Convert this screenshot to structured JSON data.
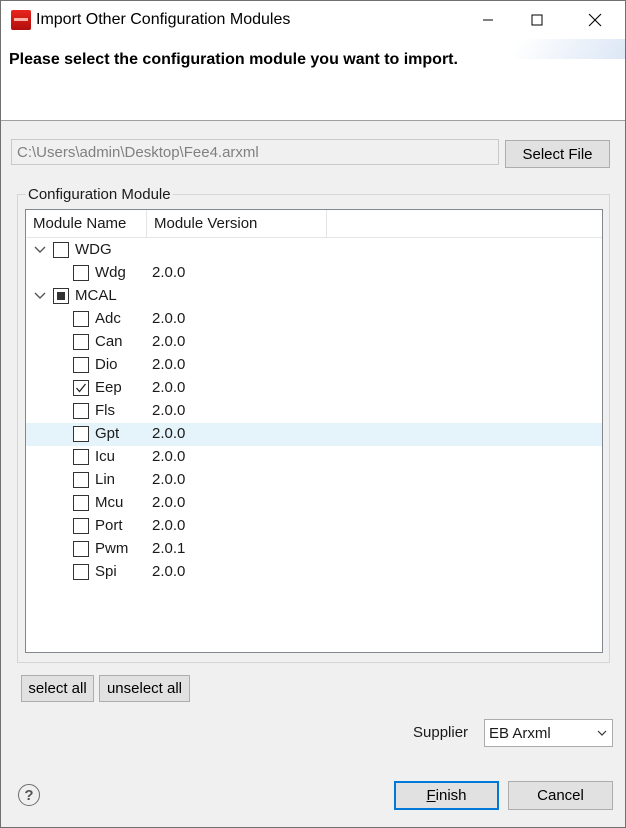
{
  "window": {
    "title": "Import Other Configuration Modules",
    "app_icon": "app-logo-icon",
    "controls": [
      "minimize-icon",
      "maximize-icon",
      "close-icon"
    ]
  },
  "banner": {
    "message": "Please select the configuration module you want to import."
  },
  "file": {
    "path": "C:\\Users\\admin\\Desktop\\Fee4.arxml",
    "select_button": "Select File"
  },
  "config_group": {
    "label": "Configuration Module",
    "columns": [
      "Module Name",
      "Module Version"
    ],
    "tree": [
      {
        "label": "WDG",
        "level": 0,
        "expanded": true,
        "state": "unchecked",
        "version": ""
      },
      {
        "label": "Wdg",
        "level": 1,
        "state": "unchecked",
        "version": "2.0.0"
      },
      {
        "label": "MCAL",
        "level": 0,
        "expanded": true,
        "state": "partial",
        "version": ""
      },
      {
        "label": "Adc",
        "level": 1,
        "state": "unchecked",
        "version": "2.0.0"
      },
      {
        "label": "Can",
        "level": 1,
        "state": "unchecked",
        "version": "2.0.0"
      },
      {
        "label": "Dio",
        "level": 1,
        "state": "unchecked",
        "version": "2.0.0"
      },
      {
        "label": "Eep",
        "level": 1,
        "state": "checked",
        "version": "2.0.0"
      },
      {
        "label": "Fls",
        "level": 1,
        "state": "unchecked",
        "version": "2.0.0"
      },
      {
        "label": "Gpt",
        "level": 1,
        "state": "unchecked",
        "version": "2.0.0",
        "highlighted": true
      },
      {
        "label": "Icu",
        "level": 1,
        "state": "unchecked",
        "version": "2.0.0"
      },
      {
        "label": "Lin",
        "level": 1,
        "state": "unchecked",
        "version": "2.0.0"
      },
      {
        "label": "Mcu",
        "level": 1,
        "state": "unchecked",
        "version": "2.0.0"
      },
      {
        "label": "Port",
        "level": 1,
        "state": "unchecked",
        "version": "2.0.0"
      },
      {
        "label": "Pwm",
        "level": 1,
        "state": "unchecked",
        "version": "2.0.1"
      },
      {
        "label": "Spi",
        "level": 1,
        "state": "unchecked",
        "version": "2.0.0"
      }
    ]
  },
  "actions": {
    "select_all": "select all",
    "unselect_all": "unselect all"
  },
  "supplier": {
    "label": "Supplier",
    "value": "EB Arxml"
  },
  "footer": {
    "help": "?",
    "finish_mnemonic": "F",
    "finish_rest": "inish",
    "cancel": "Cancel"
  },
  "colors": {
    "highlight_row": "#e5f3fb",
    "default_button_border": "#0078d7"
  }
}
